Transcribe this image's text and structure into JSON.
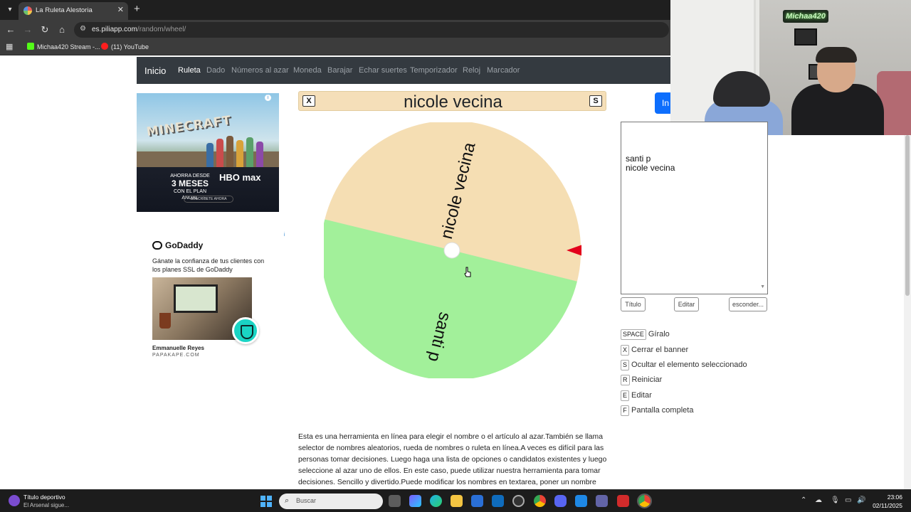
{
  "browser": {
    "tab_title": "La Ruleta Alestoria",
    "url_host": "es.piliapp.com",
    "url_path": "/random/wheel/",
    "bookmarks": [
      "Michaa420 Stream -...",
      "(11) YouTube"
    ]
  },
  "webcam": {
    "sign_text": "Michaa420"
  },
  "site": {
    "brand": "Inicio",
    "nav": [
      "Ruleta",
      "Dado",
      "Números al azar",
      "Moneda",
      "Barajar",
      "Echar suertes",
      "Temporizador",
      "Reloj",
      "Marcador"
    ],
    "active_nav": "Ruleta"
  },
  "ads": {
    "hbo": {
      "game_title": "MINECRAFT",
      "promo_line1": "AHORRA DESDE",
      "promo_big": "3 MESES",
      "promo_line2": "CON EL PLAN ANUAL",
      "brand": "HBO max",
      "cta": "SUSCRÍBETE AHORA"
    },
    "godaddy": {
      "brand": "GoDaddy",
      "text": "Gánate la confianza de tus clientes con los planes SSL de GoDaddy",
      "author": "Emmanuelle Reyes",
      "site": "PAPAKAPE.COM"
    }
  },
  "banner": {
    "close_key": "X",
    "title": "nicole vecina",
    "hide_key": "S"
  },
  "wheel": {
    "segments": [
      {
        "label": "nicole vecina",
        "color": "#f5deb3"
      },
      {
        "label": "santi p",
        "color": "#a2f09a"
      }
    ],
    "pointer_color": "#e3001b"
  },
  "controls": {
    "side_button_label": "In",
    "names_text": "santi p\nnicole vecina",
    "buttons": {
      "title": "Título",
      "edit": "Editar",
      "hide": "esconder..."
    }
  },
  "shortcuts": [
    {
      "key": "SPACE",
      "label": "Gíralo"
    },
    {
      "key": "X",
      "label": "Cerrar el banner"
    },
    {
      "key": "S",
      "label": "Ocultar el elemento seleccionado"
    },
    {
      "key": "R",
      "label": "Reiniciar"
    },
    {
      "key": "E",
      "label": "Editar"
    },
    {
      "key": "F",
      "label": "Pantalla completa"
    }
  ],
  "description": "Esta es una herramienta en línea para elegir el nombre o el artículo al azar.También se llama selector de nombres aleatorios, rueda de nombres o ruleta en línea.A veces es difícil para las personas tomar decisiones. Luego haga una lista de opciones o candidatos existentes y luego seleccione al azar uno de ellos. En este caso, puede utilizar nuestra herramienta para tomar decisiones. Sencillo y divertido.Puede modificar los nombres en textarea, poner un nombre",
  "taskbar": {
    "news_title": "Título deportivo",
    "news_subtitle": "El Arsenal sigue...",
    "search_placeholder": "Buscar",
    "time": "23:06",
    "date": "02/11/2025"
  }
}
